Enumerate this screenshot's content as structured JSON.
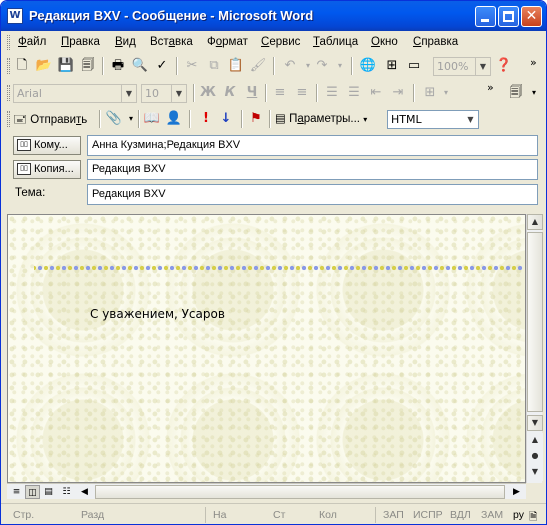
{
  "window": {
    "title": "Редакция BXV - Сообщение - Microsoft Word",
    "app_icon": "W"
  },
  "menu": [
    {
      "pre": "",
      "u": "Ф",
      "post": "айл"
    },
    {
      "pre": "",
      "u": "П",
      "post": "равка"
    },
    {
      "pre": "",
      "u": "В",
      "post": "ид"
    },
    {
      "pre": "Вст",
      "u": "а",
      "post": "вка"
    },
    {
      "pre": "Ф",
      "u": "о",
      "post": "рмат"
    },
    {
      "pre": "",
      "u": "С",
      "post": "ервис"
    },
    {
      "pre": "",
      "u": "Т",
      "post": "аблица"
    },
    {
      "pre": "",
      "u": "О",
      "post": "кно"
    },
    {
      "pre": "",
      "u": "С",
      "post": "правка"
    }
  ],
  "toolbar": {
    "zoom_value": "100%"
  },
  "format_bar": {
    "font_name": "Arial",
    "font_size": "10",
    "bold": "Ж",
    "italic": "К",
    "underline": "Ч"
  },
  "mail_bar": {
    "send_pre": "Отправи",
    "send_u": "т",
    "send_post": "ь",
    "params_pre": "П",
    "params_u": "а",
    "params_post": "раметры...",
    "format_value": "HTML"
  },
  "fields": {
    "to_label": "Кому...",
    "to_value": "Анна Кузмина;Редакция BXV",
    "cc_label": "Копия...",
    "cc_value": "Редакция BXV",
    "subject_label": "Тема:",
    "subject_value": "Редакция BXV"
  },
  "document": {
    "signature": "С уважением, Усаров"
  },
  "status": {
    "page": "Стр.",
    "section": "Разд",
    "at": "На",
    "line": "Ст",
    "col": "Кол",
    "rec": "ЗАП",
    "trk": "ИСПР",
    "ext": "ВДЛ",
    "ovr": "ЗАМ",
    "lang": "ру"
  }
}
